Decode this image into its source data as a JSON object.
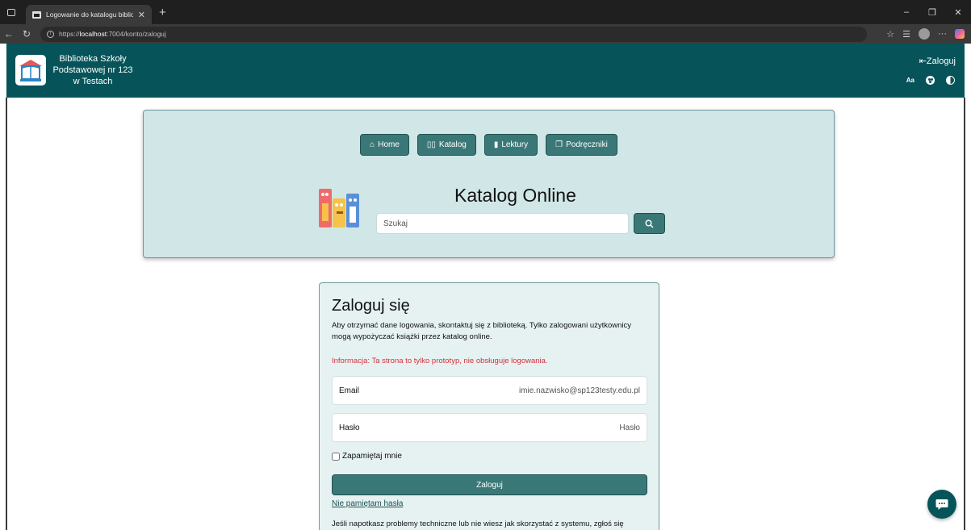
{
  "browser": {
    "tab_title": "Logowanie do katalogu bibliotek",
    "url_prefix": "https://",
    "url_host": "localhost",
    "url_path": ":7004/konto/zaloguj"
  },
  "header": {
    "school_name": "Biblioteka Szkoły Podstawowej nr 123 w Testach",
    "login_label": "Zaloguj",
    "font_size_label": "Aa"
  },
  "nav": {
    "home": "Home",
    "catalog": "Katalog",
    "readings": "Lektury",
    "textbooks": "Podręczniki"
  },
  "search": {
    "title": "Katalog Online",
    "placeholder": "Szukaj"
  },
  "login_form": {
    "title": "Zaloguj się",
    "description": "Aby otrzymać dane logowania, skontaktuj się z biblioteką. Tylko zalogowani użytkownicy mogą wypożyczać książki przez katalog online.",
    "info": "Informacja: Ta strona to tylko prototyp, nie obsługuje logowania.",
    "email_label": "Email",
    "email_placeholder": "imie.nazwisko@sp123testy.edu.pl",
    "password_label": "Hasło",
    "password_placeholder": "Hasło",
    "remember_label": "Zapamiętaj mnie",
    "submit_label": "Zaloguj",
    "forgot_label": "Nie pamiętam hasła",
    "help_text": "Jeśli napotkasz problemy techniczne lub nie wiesz jak skorzystać z systemu, zgłoś się"
  },
  "colors": {
    "header_bg": "#06545a",
    "button_bg": "#3a7877",
    "panel_bg": "#d1e6e7",
    "info_red": "#d1313b"
  }
}
